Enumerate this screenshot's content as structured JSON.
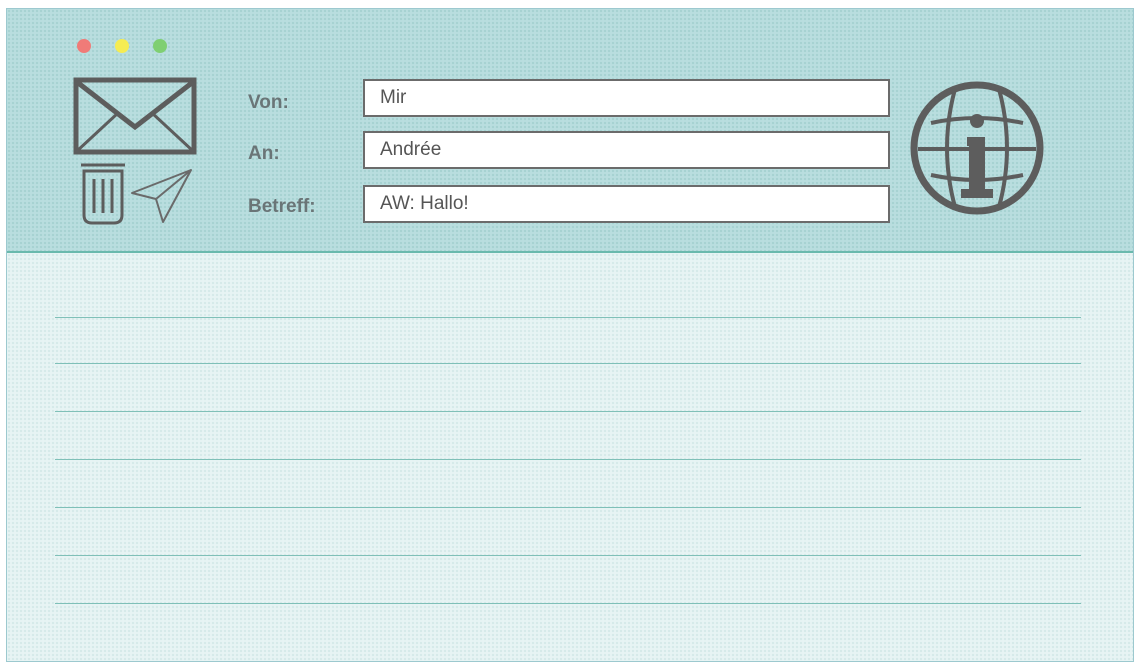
{
  "window": {
    "buttons": [
      "close",
      "minimize",
      "zoom"
    ]
  },
  "header": {
    "icons": {
      "mail": "mail-icon",
      "trash": "trash-icon",
      "send": "send-icon",
      "info": "globe-info-icon"
    },
    "labels": {
      "from": "Von:",
      "to": "An:",
      "subject": "Betreff:"
    },
    "values": {
      "from": "Mir",
      "to": "Andrée",
      "subject": "AW: Hallo!"
    }
  },
  "body": {
    "ruled_lines": 7,
    "text": ""
  },
  "colors": {
    "header_bg": "#b9dedf",
    "body_bg": "#e7f4f4",
    "line": "#7fc0b8",
    "icon": "#5d5d5d",
    "close": "#f07b78",
    "minimize": "#f5ec52",
    "zoom": "#7fcf72"
  }
}
